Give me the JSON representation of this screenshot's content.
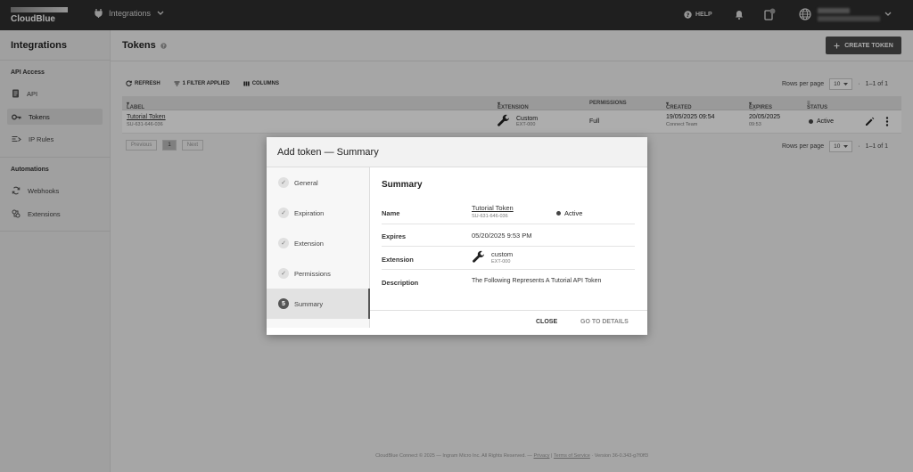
{
  "topbar": {
    "brand": "CloudBlue",
    "module": "Integrations",
    "help": "HELP"
  },
  "sidebar": {
    "title": "Integrations",
    "section_api": "API Access",
    "items_api": [
      {
        "label": "API"
      },
      {
        "label": "Tokens"
      },
      {
        "label": "IP Rules"
      }
    ],
    "section_auto": "Automations",
    "items_auto": [
      {
        "label": "Webhooks"
      },
      {
        "label": "Extensions"
      }
    ]
  },
  "main": {
    "title": "Tokens",
    "create_button": "CREATE TOKEN",
    "toolbar": {
      "refresh": "REFRESH",
      "filter": "1 FILTER APPLIED",
      "columns": "COLUMNS"
    },
    "pager": {
      "rows_label": "Rows per page",
      "rows_value": "10",
      "range": "1–1 of 1"
    },
    "columns": [
      "LABEL",
      "EXTENSION",
      "PERMISSIONS",
      "CREATED",
      "EXPIRES AT",
      "STATUS"
    ],
    "row": {
      "label": "Tutorial Token",
      "label_id": "SU-631-646-036",
      "extension": "Custom",
      "extension_id": "EXT-000",
      "permissions": "Full",
      "created": "19/05/2025 09:54",
      "created_by": "Connect Team",
      "expires": "20/05/2025",
      "expires_time": "09:53",
      "status": "Active"
    },
    "pagination": {
      "prev": "Previous",
      "page": "1",
      "next": "Next"
    }
  },
  "dialog": {
    "title": "Add token — Summary",
    "steps": [
      {
        "label": "General",
        "state": "done"
      },
      {
        "label": "Expiration",
        "state": "done"
      },
      {
        "label": "Extension",
        "state": "done"
      },
      {
        "label": "Permissions",
        "state": "done"
      },
      {
        "label": "Summary",
        "state": "active",
        "number": "5"
      }
    ],
    "summary": {
      "title": "Summary",
      "name_key": "Name",
      "name_value": "Tutorial Token",
      "name_id": "SU-631-646-036",
      "status": "Active",
      "expires_key": "Expires",
      "expires_value": "05/20/2025 9:53 PM",
      "extension_key": "Extension",
      "extension_value": "custom",
      "extension_id": "EXT-000",
      "description_key": "Description",
      "description_value": "The Following Represents A Tutorial API Token"
    },
    "close": "CLOSE",
    "go_to_details": "GO TO DETAILS"
  },
  "footer": {
    "copyright": "CloudBlue Connect © 2025 — Ingram Micro Inc. All Rights Reserved. —",
    "privacy": "Privacy",
    "separator": "|",
    "terms": "Terms of Service",
    "version": "· Version 36-0.343-g7f0ff3"
  },
  "colors": {
    "topbar": "#2e2e2e",
    "primary_button": "#4a4a4a",
    "overlay": "rgba(0,0,0,0.32)"
  }
}
